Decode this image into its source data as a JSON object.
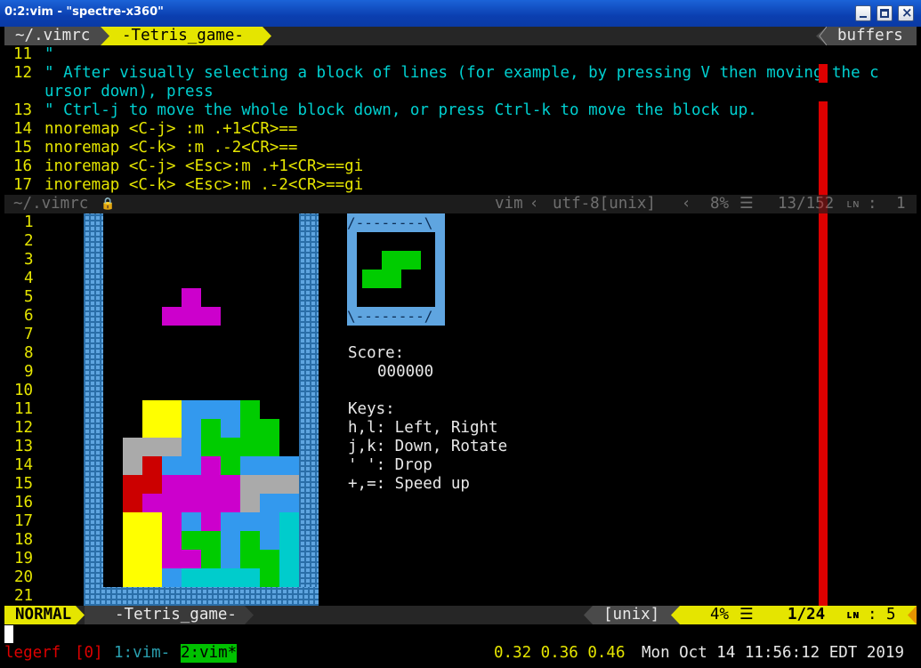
{
  "window": {
    "title": "0:2:vim - \"spectre-x360\""
  },
  "tabline": {
    "tab1": "~/.vimrc",
    "tab2": "-Tetris_game-",
    "right": "buffers"
  },
  "vimrc": {
    "lines": [
      {
        "n": "11",
        "text": "\"",
        "cls": "cyan"
      },
      {
        "n": "12",
        "text": "\" After visually selecting a block of lines (for example, by pressing V then moving the c",
        "cls": "cyan"
      },
      {
        "n": "",
        "text": "ursor down), press",
        "cls": "cyan"
      },
      {
        "n": "13",
        "text": "\" Ctrl-j to move the whole block down, or press Ctrl-k to move the block up.",
        "cls": "cyan"
      },
      {
        "n": "14",
        "text": "nnoremap <C-j> :m .+1<CR>==",
        "cls": "yellow"
      },
      {
        "n": "15",
        "text": "nnoremap <C-k> :m .-2<CR>==",
        "cls": "yellow"
      },
      {
        "n": "16",
        "text": "inoremap <C-j> <Esc>:m .+1<CR>==gi",
        "cls": "yellow"
      },
      {
        "n": "17",
        "text": "inoremap <C-k> <Esc>:m .-2<CR>==gi",
        "cls": "yellow"
      }
    ],
    "status": {
      "file": "~/.vimrc",
      "ft": "vim",
      "enc": "utf-8[unix]",
      "pct": "8%",
      "pos": "13/152",
      "col": "1"
    }
  },
  "tetris": {
    "line_numbers": [
      "1",
      "2",
      "3",
      "4",
      "5",
      "6",
      "7",
      "8",
      "9",
      "10",
      "11",
      "12",
      "13",
      "14",
      "15",
      "16",
      "17",
      "18",
      "19",
      "20",
      "21"
    ],
    "board": [
      "..........",
      "..........",
      "..........",
      "..........",
      "....P.....",
      "...PPP....",
      "..........",
      "..........",
      "..........",
      "..........",
      "..YYBBBG..",
      "..YYBGBGG.",
      ".WWWBGGGG.",
      ".WRBBPGBBB",
      ".RRPPPPWWW",
      ".RPPPPPWBB",
      ".YYPBPBBBC",
      ".YYPGGBGBC",
      ".YYPPGBGGC",
      ".YYBCCCCGC",
      ".........."
    ],
    "colors": {
      "P": "#cc00cc",
      "Y": "#ffff00",
      "B": "#3399ee",
      "G": "#00cc00",
      "W": "#aaaaaa",
      "R": "#cc0000",
      "C": "#00cccc"
    },
    "next_piece": [
      "..",
      ".GG",
      "GG."
    ],
    "score_label": "Score:",
    "score": "000000",
    "keys_title": "Keys:",
    "keys": [
      "h,l: Left, Right",
      "j,k: Down, Rotate",
      "' ': Drop",
      "+,=: Speed up"
    ],
    "status": {
      "mode": "NORMAL",
      "file": "-Tetris_game-",
      "ff": "[unix]",
      "pct": "4%",
      "pos": "1/24",
      "col": "5"
    }
  },
  "tmux": {
    "session": "legerf",
    "session_idx": "[0]",
    "win1": "1:vim-",
    "win2": "2:vim*",
    "load": "0.32 0.36 0.46",
    "datetime": "Mon Oct 14 11:56:12 EDT 2019"
  }
}
